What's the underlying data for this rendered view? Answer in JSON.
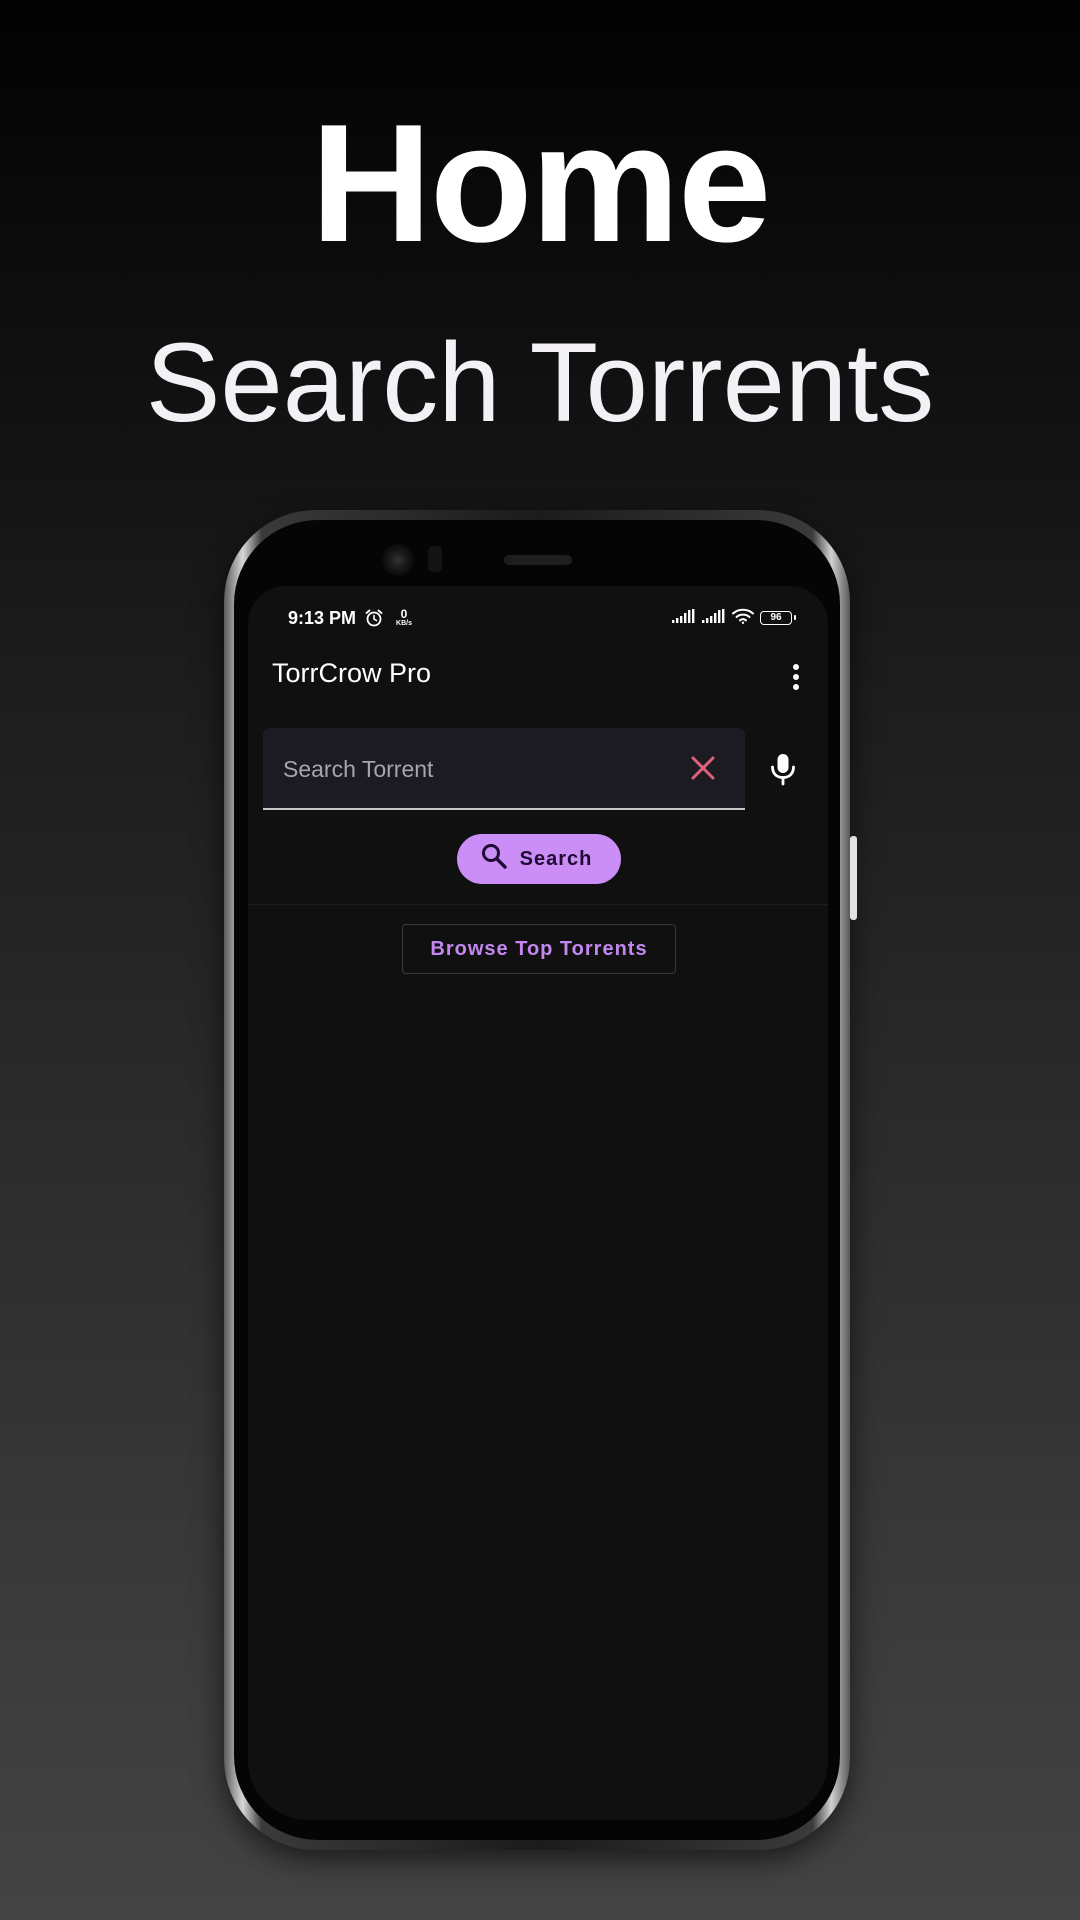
{
  "promo": {
    "title": "Home",
    "subtitle": "Search Torrents"
  },
  "status_bar": {
    "time": "9:13 PM",
    "net_speed_value": "0",
    "net_speed_unit": "KB/s",
    "battery_level": "96",
    "icons": [
      "alarm-icon",
      "signal-icon",
      "signal-icon",
      "wifi-icon",
      "battery-icon"
    ]
  },
  "app_bar": {
    "title": "TorrCrow Pro",
    "menu_icon": "more-vertical-icon"
  },
  "search": {
    "placeholder": "Search Torrent",
    "value": "",
    "clear_icon": "close-icon",
    "mic_icon": "microphone-icon",
    "button_label": "Search",
    "button_icon": "search-icon"
  },
  "browse": {
    "label": "Browse Top Torrents"
  },
  "colors": {
    "accent": "#cb8ef7",
    "accent_text": "#c487f0",
    "clear_icon": "#e0627a",
    "screen_bg": "#101010",
    "field_bg": "#1c1b22"
  }
}
